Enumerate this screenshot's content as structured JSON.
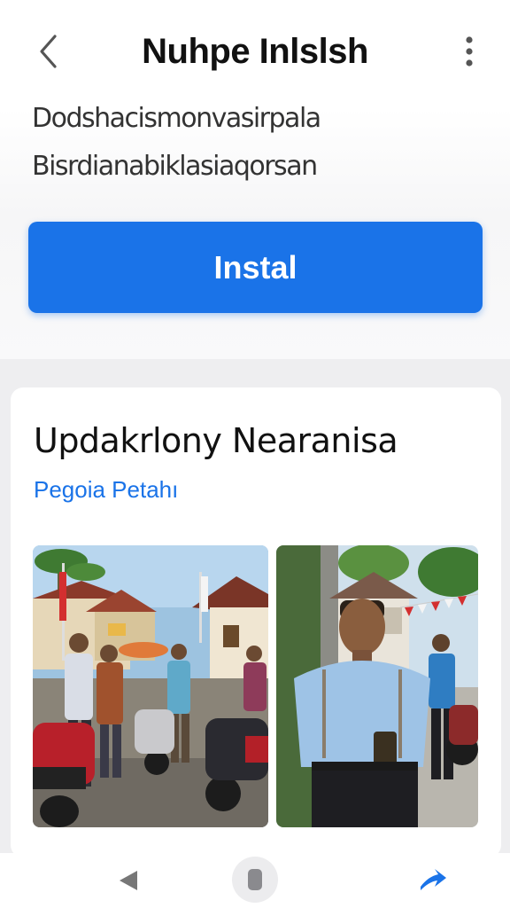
{
  "header": {
    "title": "Nuhpe Inlslsh",
    "back_icon": "chevron-left-icon",
    "menu_icon": "more-vert-icon"
  },
  "description": {
    "line1": "Dodshacismonvasirpala",
    "line2": "Bisrdianabiklasiaqorsan"
  },
  "install_button": {
    "label": "Instal",
    "color": "#1a73e8"
  },
  "card": {
    "title": "Updakrlony Nearanisa",
    "link": "Pegoia Petahı",
    "photos": [
      "street-scene-photo",
      "man-portrait-photo"
    ]
  },
  "bottom_nav": {
    "back_icon": "triangle-back-icon",
    "home_icon": "home-pill-icon",
    "forward_icon": "forward-arrow-icon",
    "accent": "#1a73e8"
  }
}
